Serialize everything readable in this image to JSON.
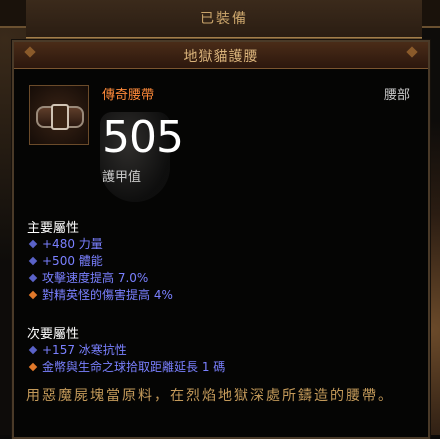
{
  "header": {
    "equipped_label": "已裝備"
  },
  "item": {
    "name": "地獄貓護腰",
    "type": "傳奇腰帶",
    "slot": "腰部",
    "armor_value": "505",
    "armor_label": "護甲值",
    "icon": "belt-icon"
  },
  "primary": {
    "title": "主要屬性",
    "stats": [
      {
        "text": "+480 力量",
        "bullet": "blue",
        "color": "#7a80ff"
      },
      {
        "text": "+500 體能",
        "bullet": "blue",
        "color": "#7a80ff"
      },
      {
        "text": "攻擊速度提高 7.0%",
        "bullet": "blue",
        "color": "#7a80ff"
      },
      {
        "text": "對精英怪的傷害提高 4%",
        "bullet": "orange",
        "color": "#7a80ff"
      }
    ]
  },
  "secondary": {
    "title": "次要屬性",
    "stats": [
      {
        "text": "+157 冰寒抗性",
        "bullet": "blue",
        "color": "#7a80ff"
      },
      {
        "text": "金幣與生命之球拾取距離延長 1 碼",
        "bullet": "orange",
        "color": "#7a80ff"
      }
    ]
  },
  "flavor": "用惡魔屍塊當原料，在烈焰地獄深處所鑄造的腰帶。",
  "colors": {
    "legendary_orange": "#ff8a3a",
    "magic_blue": "#7a80ff",
    "flavor_gold": "#c49a5a"
  }
}
